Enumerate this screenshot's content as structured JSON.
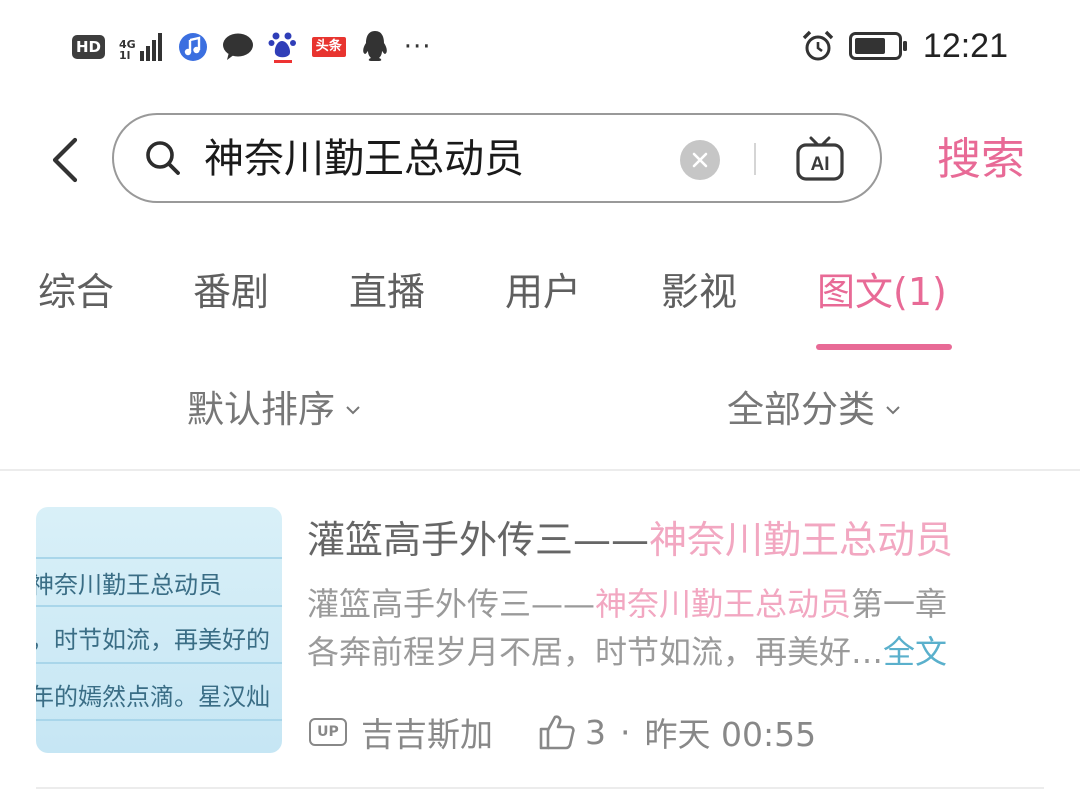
{
  "status_bar": {
    "hd": "HD",
    "network_top": "4G",
    "network_bottom": "1l",
    "toutiao": "头条",
    "more": "···",
    "time": "12:21"
  },
  "search": {
    "query": "神奈川勤王总动员",
    "ai_label": "AI",
    "submit_label": "搜索"
  },
  "tabs": [
    {
      "label": "综合"
    },
    {
      "label": "番剧"
    },
    {
      "label": "直播"
    },
    {
      "label": "用户"
    },
    {
      "label": "影视"
    },
    {
      "label": "图文(1)",
      "active": true
    }
  ],
  "sort": {
    "order_label": "默认排序",
    "category_label": "全部分类"
  },
  "result": {
    "thumbnail_lines": [
      "神奈川勤王总动员",
      "，时节如流，再美好的",
      "年的嫣然点滴。星汉灿"
    ],
    "title_prefix": "灌篮高手外传三——",
    "title_highlight": "神奈川勤王总动员",
    "snippet_prefix": "灌篮高手外传三——",
    "snippet_highlight": "神奈川勤王总动员",
    "snippet_after_highlight": "第一章",
    "snippet_line2": "各奔前程岁月不居，时节如流，再美好…",
    "full_text_label": "全文",
    "up_badge": "UP",
    "author": "吉吉斯加",
    "likes": "3",
    "separator": "·",
    "time": "昨天 00:55"
  },
  "colors": {
    "accent_pink": "#e86a96",
    "highlight_pink": "#f2a7c1",
    "link_blue": "#5ab0cc"
  }
}
